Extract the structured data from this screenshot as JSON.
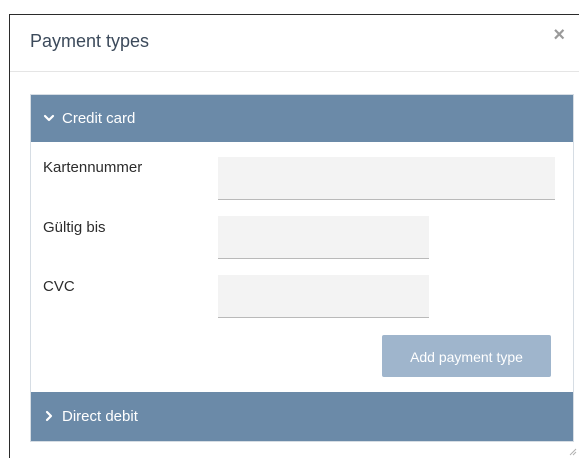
{
  "dialog": {
    "title": "Payment types",
    "close_glyph": "×"
  },
  "accordion": {
    "credit": {
      "label": "Credit card",
      "icon": "chevron-down-icon",
      "expanded": true
    },
    "debit": {
      "label": "Direct debit",
      "icon": "chevron-right-icon",
      "expanded": false
    }
  },
  "form": {
    "card_number_label": "Kartennummer",
    "card_number_value": "",
    "valid_until_label": "Gültig bis",
    "valid_until_value": "",
    "cvc_label": "CVC",
    "cvc_value": "",
    "submit_label": "Add payment type"
  },
  "colors": {
    "accordion_header": "#6b8aa8",
    "button": "#9fb5cc",
    "input_bg": "#f3f3f3",
    "title_text": "#3c4a5b"
  }
}
